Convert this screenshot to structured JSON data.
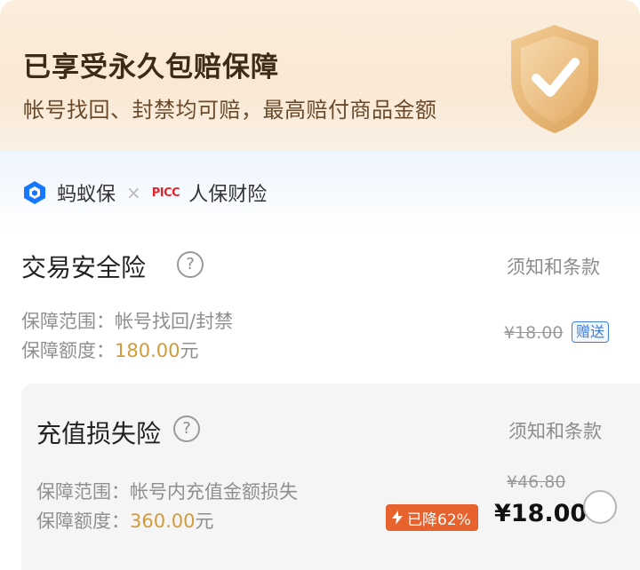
{
  "banner": {
    "title": "已享受永久包赔保障",
    "subtitle": "帐号找回、封禁均可赔，最高赔付商品金额"
  },
  "brand": {
    "partner1": "蚂蚁保",
    "separator": "×",
    "picc_logo": "PICC",
    "partner2": "人保财险"
  },
  "insurance_1": {
    "title": "交易安全险",
    "help": "?",
    "terms_link": "须知和条款",
    "scope_label": "保障范围：",
    "scope_value": "帐号找回/封禁",
    "amount_label": "保障额度：",
    "amount_value": "180.00",
    "amount_unit": "元",
    "original_price": "¥18.00",
    "gift_tag": "赠送"
  },
  "insurance_2": {
    "title": "充值损失险",
    "help": "?",
    "terms_link": "须知和条款",
    "scope_label": "保障范围：",
    "scope_value": "帐号内充值金额损失",
    "amount_label": "保障额度：",
    "amount_value": "360.00",
    "amount_unit": "元",
    "original_price": "¥46.80",
    "discount_badge": "已降62%",
    "price": "¥18.00",
    "selected": false
  },
  "colors": {
    "gold": "#d19b3a",
    "discount": "#e8622f",
    "link_blue": "#3b7ddd",
    "picc_red": "#e0262c"
  },
  "icons": {
    "shield": "shield-check-icon",
    "brand": "antbao-logo-icon",
    "help": "question-circle-icon",
    "bolt": "lightning-icon"
  }
}
